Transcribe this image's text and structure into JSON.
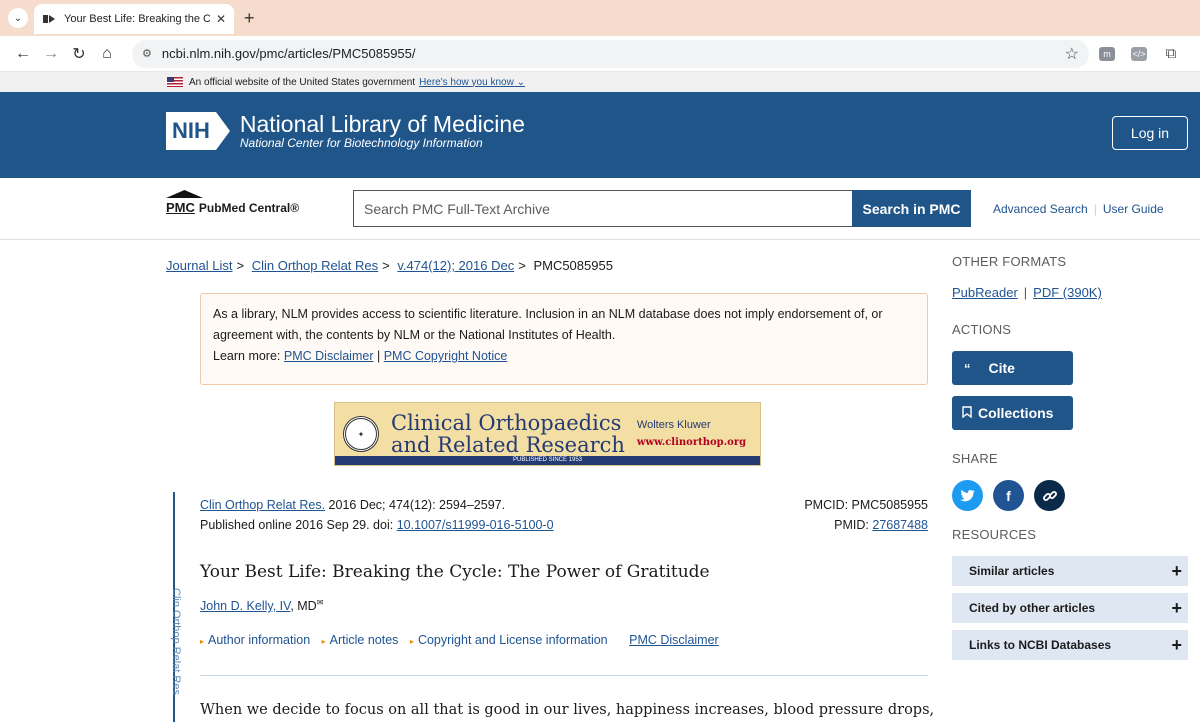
{
  "browser": {
    "tab_title": "Your Best Life: Breaking the Cyc",
    "url": "ncbi.nlm.nih.gov/pmc/articles/PMC5085955/"
  },
  "gov_banner": {
    "text": "An official website of the United States government",
    "link": "Here's how you know"
  },
  "header": {
    "logo_text": "NIH",
    "title": "National Library of Medicine",
    "subtitle": "National Center for Biotechnology Information",
    "login": "Log in"
  },
  "search": {
    "brand_pmc": "PMC",
    "brand_name": "PubMed Central®",
    "placeholder": "Search PMC Full-Text Archive",
    "button": "Search in PMC",
    "advanced": "Advanced Search",
    "guide": "User Guide"
  },
  "breadcrumb": {
    "items": [
      "Journal List",
      "Clin Orthop Relat Res",
      "v.474(12); 2016 Dec"
    ],
    "current": "PMC5085955",
    "sep": ">"
  },
  "notice": {
    "text": "As a library, NLM provides access to scientific literature. Inclusion in an NLM database does not imply endorsement of, or agreement with, the contents by NLM or the National Institutes of Health.",
    "learn_more": "Learn more:",
    "link1": "PMC Disclaimer",
    "divider": "|",
    "link2": "PMC Copyright Notice"
  },
  "journal_banner": {
    "line1": "Clinical Orthopaedics",
    "line2": "and Related Research",
    "publisher": "Wolters Kluwer",
    "site": "www.clinorthop.org",
    "strip": "PUBLISHED SINCE 1953"
  },
  "article": {
    "journal_link": "Clin Orthop Relat Res.",
    "citation": "2016 Dec; 474(12): 2594–2597.",
    "published": "Published online 2016 Sep 29. doi:",
    "doi": "10.1007/s11999-016-5100-0",
    "pmcid": "PMCID: PMC5085955",
    "pmid_label": "PMID:",
    "pmid": "27687488",
    "title": "Your Best Life: Breaking the Cycle: The Power of Gratitude",
    "author": "John D. Kelly, IV",
    "author_suffix": ", MD",
    "links": [
      "Author information",
      "Article notes",
      "Copyright and License information"
    ],
    "disclaimer": "PMC Disclaimer",
    "side_label": "Clin Orthop Relat Res",
    "body_first_line": "When we decide to focus on all that is good in our lives, happiness increases, blood pressure drops,"
  },
  "sidebar": {
    "other_formats": "OTHER FORMATS",
    "pubreader": "PubReader",
    "fmt_sep": "|",
    "pdf": "PDF (390K)",
    "actions": "ACTIONS",
    "cite": "Cite",
    "collections": "Collections",
    "share": "SHARE",
    "resources": "RESOURCES",
    "resource_items": [
      "Similar articles",
      "Cited by other articles",
      "Links to NCBI Databases"
    ]
  },
  "colors": {
    "nih_blue": "#20558a",
    "twitter": "#1d9bf0",
    "facebook": "#205493",
    "link_share": "#0b2a4a"
  }
}
